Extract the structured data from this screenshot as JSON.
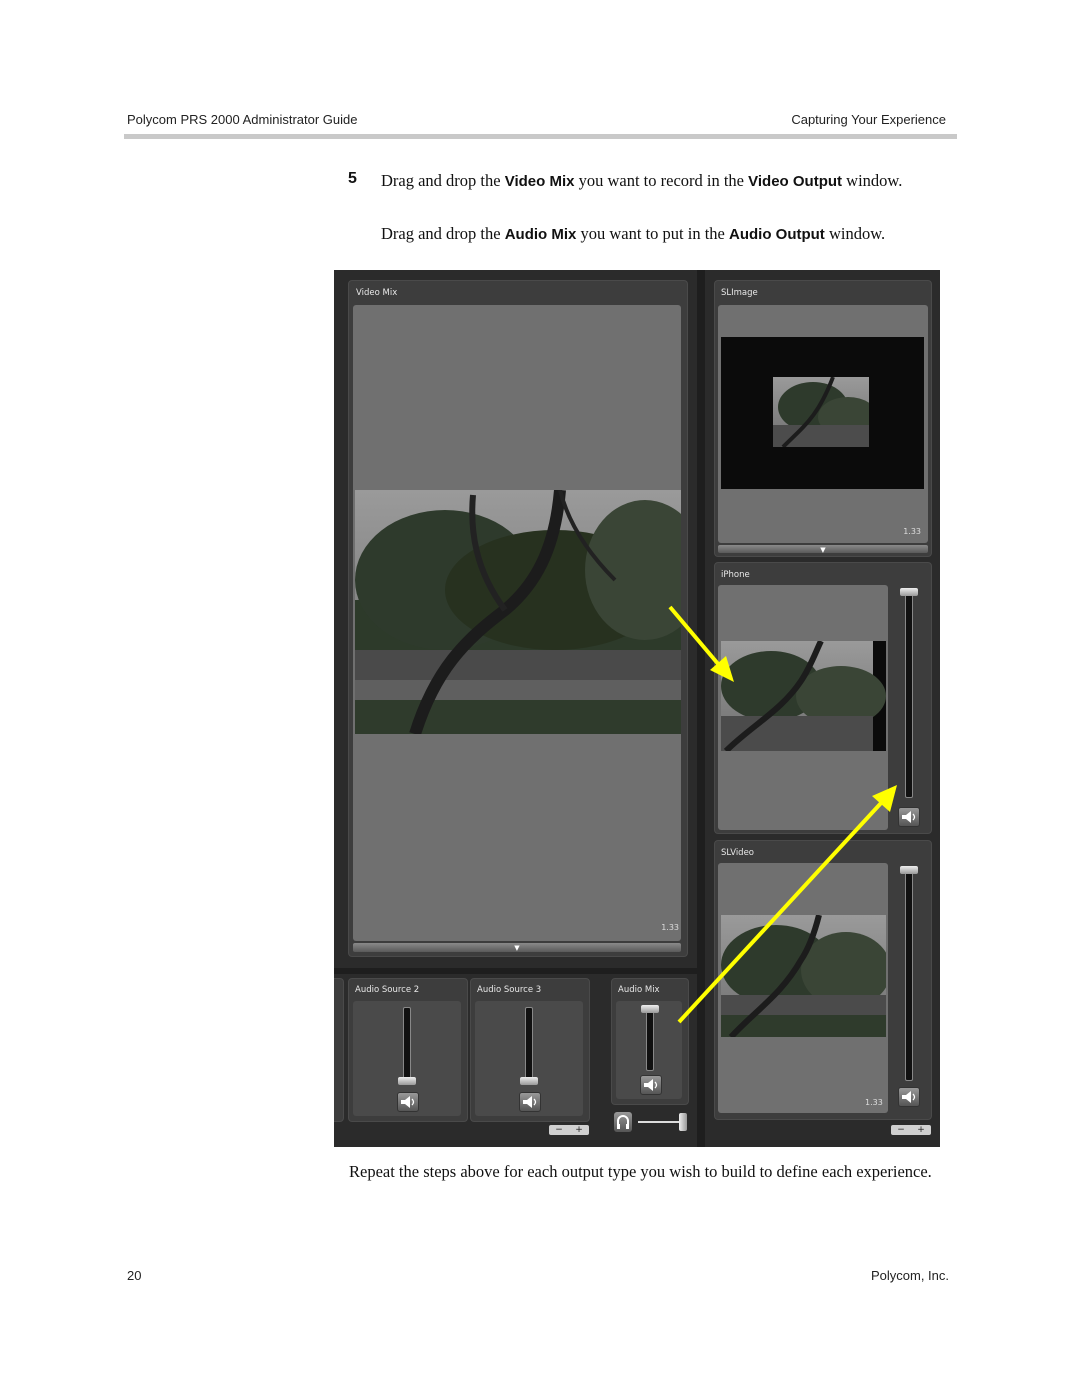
{
  "header": {
    "left": "Polycom PRS 2000 Administrator Guide",
    "right": "Capturing Your Experience"
  },
  "step": {
    "number": "5",
    "line1_a": "Drag and drop the ",
    "line1_b": "Video Mix",
    "line1_c": " you want to record in the ",
    "line1_d": "Video Output",
    "line1_e": " window.",
    "line2_a": "Drag and drop the ",
    "line2_b": "Audio Mix",
    "line2_c": " you want to put in the ",
    "line2_d": "Audio Output",
    "line2_e": " window."
  },
  "screenshot": {
    "video_mix_title": "Video Mix",
    "video_mix_ratio": "1.33",
    "slimage_title": "SLImage",
    "slimage_ratio": "1.33",
    "iphone_title": "iPhone",
    "slvideo_title": "SLVideo",
    "slvideo_ratio": "1.33",
    "audio_source2_title": "Audio Source 2",
    "audio_source3_title": "Audio Source 3",
    "audio_mix_title": "Audio Mix",
    "minus_label": "−",
    "plus_label": "+",
    "arrow_color": "#ffff00"
  },
  "closing_text": "Repeat the steps above for each output type you wish to build to define each experience.",
  "footer": {
    "page_number": "20",
    "company": "Polycom, Inc."
  }
}
